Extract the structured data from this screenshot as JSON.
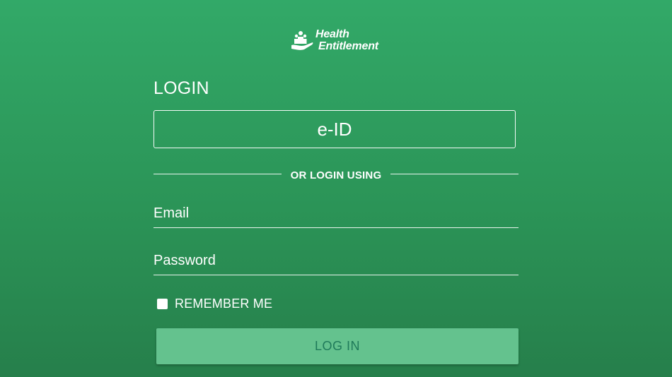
{
  "brand": {
    "logo_line1": "Health",
    "logo_line2": "Entitlement",
    "logo_icon": "family-hand-icon"
  },
  "login": {
    "heading": "LOGIN",
    "eid_button_label": "e-ID",
    "divider_text": "OR LOGIN USING",
    "email_placeholder": "Email",
    "password_placeholder": "Password",
    "remember_label": "REMEMBER ME",
    "remember_checked": false,
    "submit_label": "LOG IN"
  },
  "colors": {
    "background_top": "#32a968",
    "background_bottom": "#267f4b",
    "button_fill": "#64c28e",
    "button_text": "#1f7a5a"
  }
}
